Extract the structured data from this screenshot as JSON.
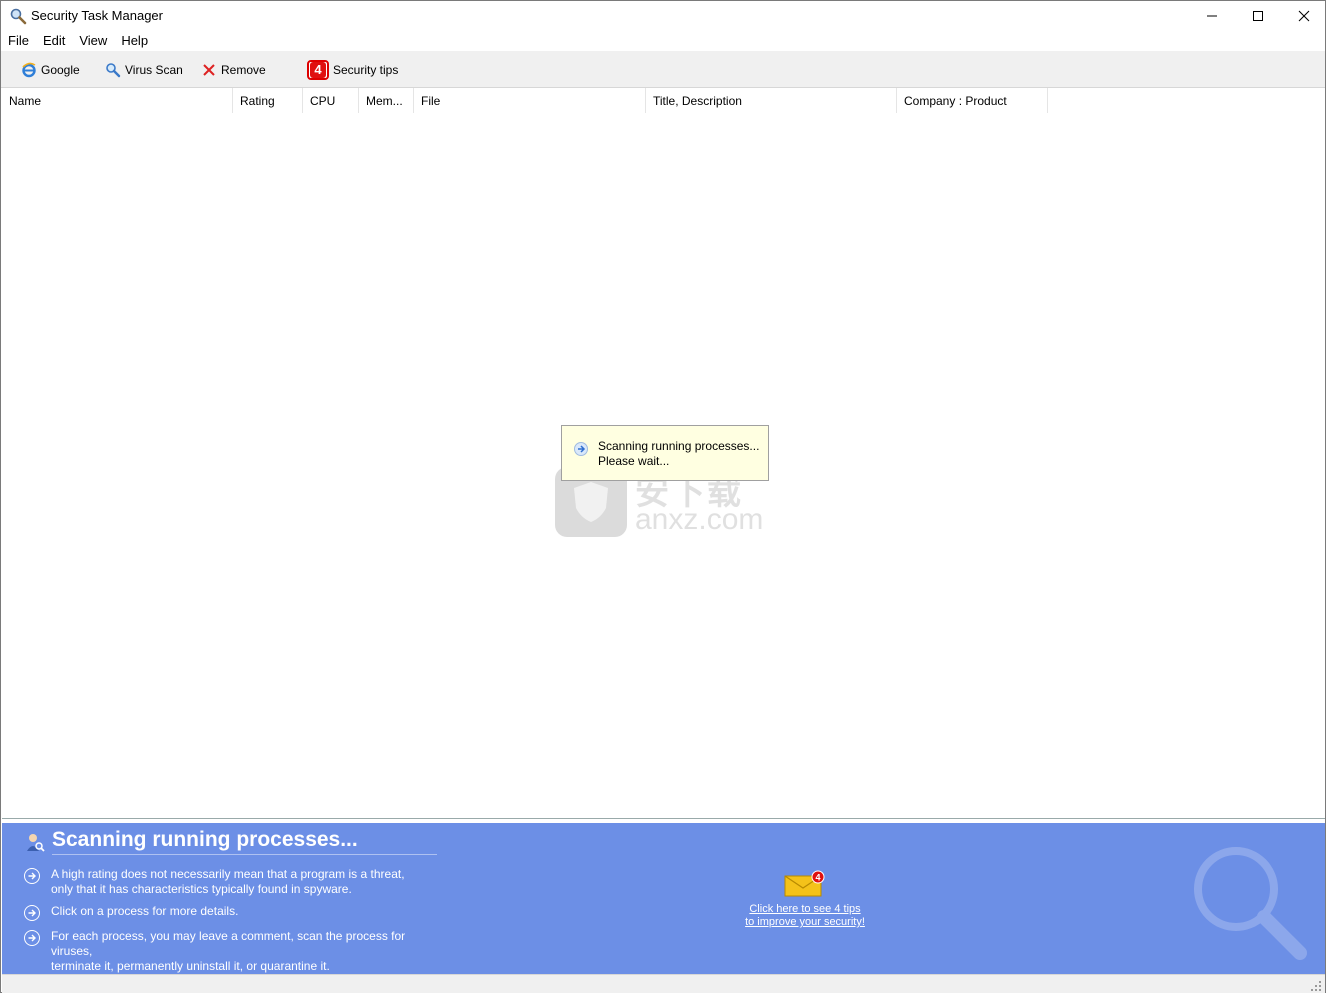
{
  "window": {
    "title": "Security Task Manager"
  },
  "menu": {
    "items": [
      {
        "label": "File"
      },
      {
        "label": "Edit"
      },
      {
        "label": "View"
      },
      {
        "label": "Help"
      }
    ]
  },
  "toolbar": {
    "google_label": "Google",
    "virus_scan_label": "Virus Scan",
    "remove_label": "Remove",
    "tips_count": "4",
    "tips_label": "Security tips"
  },
  "columns": [
    {
      "label": "Name"
    },
    {
      "label": "Rating"
    },
    {
      "label": "CPU"
    },
    {
      "label": "Mem..."
    },
    {
      "label": "File"
    },
    {
      "label": "Title, Description"
    },
    {
      "label": "Company : Product"
    }
  ],
  "popup": {
    "line1": "Scanning running processes...",
    "line2": "Please wait..."
  },
  "watermark": {
    "chinese": "安下载",
    "domain": "anxz.com"
  },
  "panel": {
    "title": "Scanning running processes...",
    "bullets": [
      {
        "line1": "A high rating does not necessarily mean that a program is a threat,",
        "line2": "only that it has characteristics typically found in spyware."
      },
      {
        "line1": "Click on a process for more details.",
        "line2": ""
      },
      {
        "line1": "For each process, you may leave a comment, scan the process for viruses,",
        "line2": "terminate it, permanently uninstall it, or quarantine it."
      }
    ],
    "mail_badge": "4",
    "tips_link_line1": "Click here to see 4 tips",
    "tips_link_line2": "to improve your security!"
  },
  "colors": {
    "panel_bg": "#6c8fe6",
    "popup_bg": "#ffffe1",
    "toolbar_bg": "#f0f0f0",
    "badge_red": "#e01010"
  }
}
